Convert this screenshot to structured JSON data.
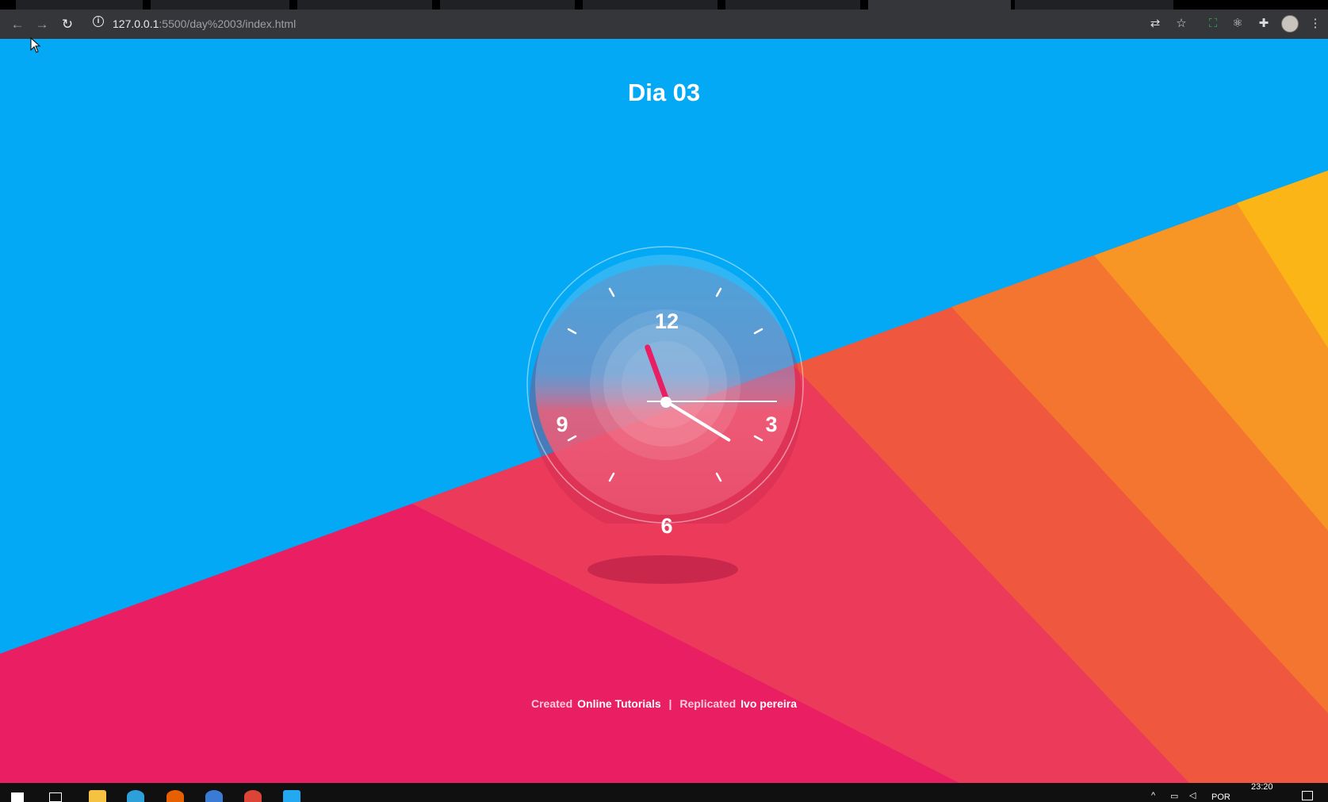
{
  "browser": {
    "tabs": [
      {
        "label": ""
      },
      {
        "label": ""
      },
      {
        "label": ""
      },
      {
        "label": ""
      },
      {
        "label": ""
      },
      {
        "label": ""
      },
      {
        "label": ""
      },
      {
        "label": ""
      }
    ],
    "nav": {
      "back": "←",
      "forward": "→",
      "reload": "↻"
    },
    "url": {
      "host": "127.0.0.1",
      "path": ":5500/day%2003/index.html"
    },
    "toolbar_icons": [
      "translate-icon",
      "star-icon",
      "screenshot-icon",
      "react-devtools-icon",
      "extensions-icon",
      "profile-avatar",
      "more-menu-icon"
    ]
  },
  "page": {
    "title": "Dia 03",
    "clock": {
      "numerals": {
        "twelve": "12",
        "three": "3",
        "six": "6",
        "nine": "9"
      },
      "time": {
        "hour": 11,
        "minute": 20,
        "second": 15
      }
    },
    "footer": {
      "created_label": "Created",
      "created_by": "Online Tutorials",
      "separator": "|",
      "replicated_label": "Replicated",
      "replicated_by": "Ivo pereira"
    },
    "colors": {
      "sky": "#03a9f4",
      "pink": "#e91e63",
      "orange": "#ff9800",
      "yellow": "#ffc107",
      "hour_hand": "#e91e63"
    }
  },
  "taskbar": {
    "apps": [
      "windows-start-icon",
      "task-view-icon",
      "file-explorer-icon",
      "edge-icon",
      "firefox-icon",
      "app-icon",
      "chrome-icon",
      "vscode-icon"
    ],
    "language": "POR",
    "time": "23:20"
  }
}
